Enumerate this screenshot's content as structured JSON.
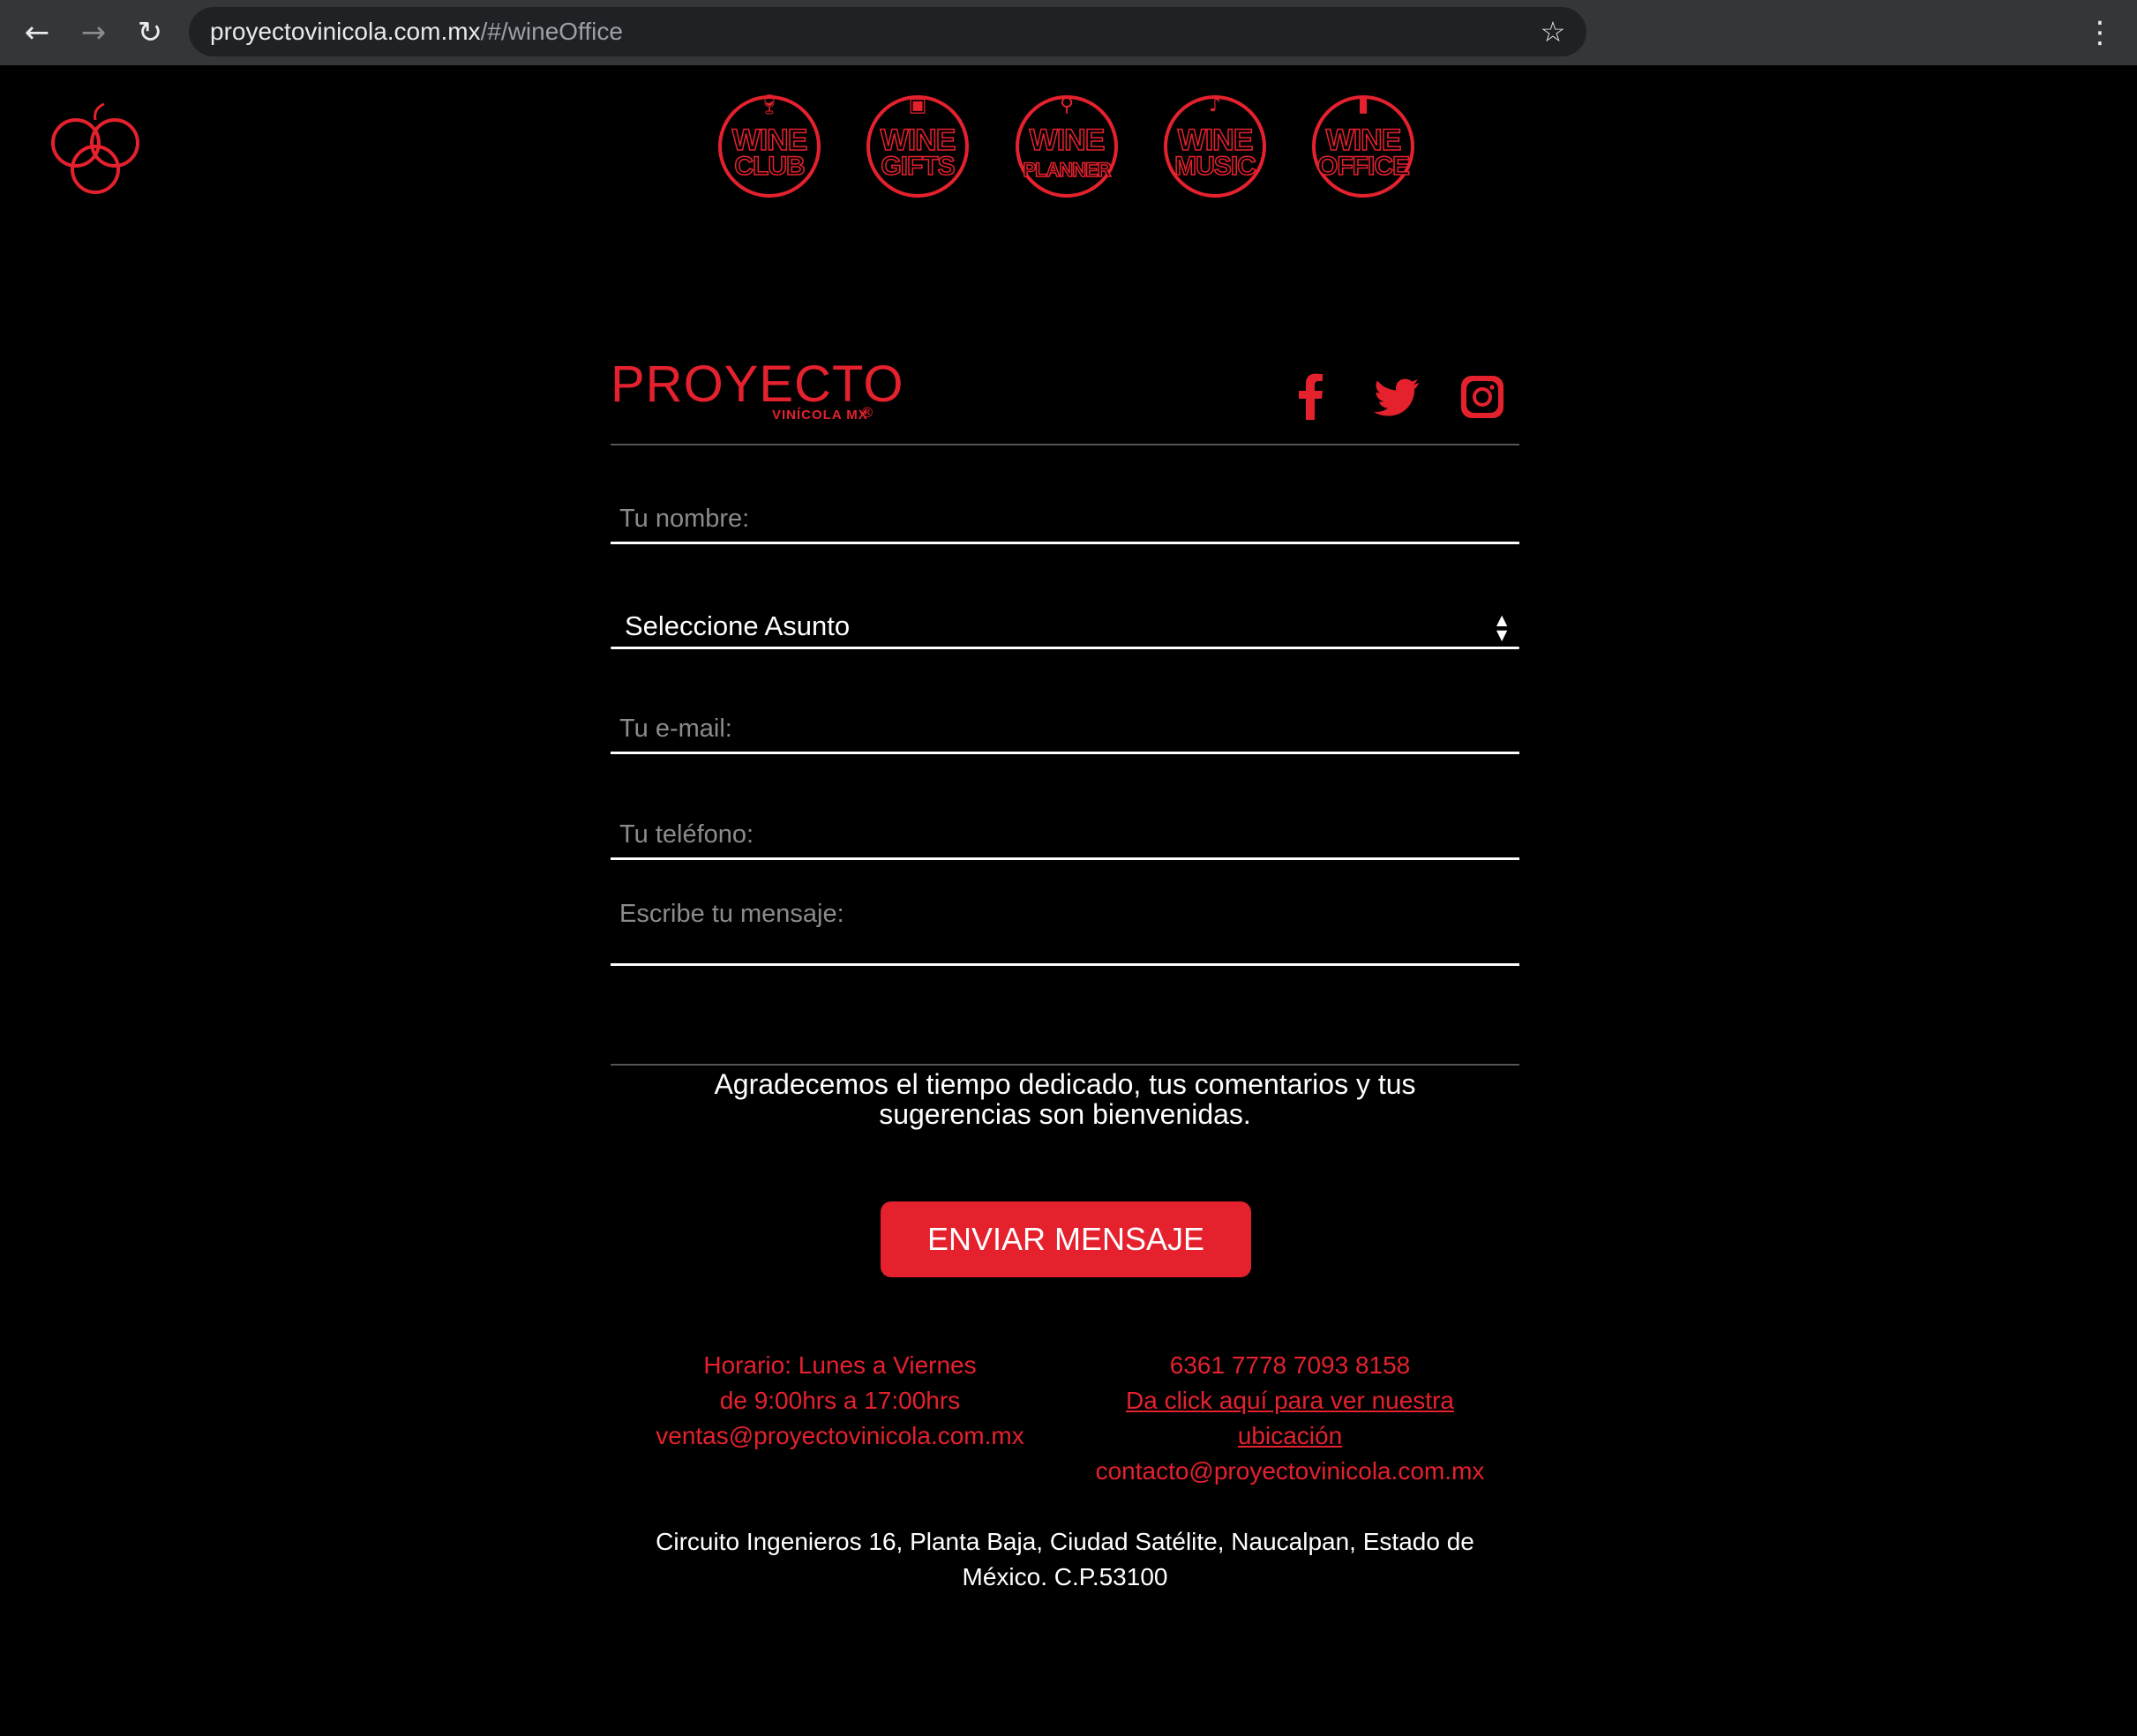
{
  "browser": {
    "url_host": "proyectovinicola.com.mx",
    "url_path": "/#/wineOffice"
  },
  "colors": {
    "accent": "#e5212e",
    "background": "#000000"
  },
  "nav": {
    "items": [
      {
        "line1": "WINE",
        "line2": "CLUB",
        "icon": "wine-glass-icon"
      },
      {
        "line1": "WINE",
        "line2": "GIFTS",
        "icon": "gift-icon"
      },
      {
        "line1": "WINE",
        "line2": "PLANNER",
        "icon": "planner-icon"
      },
      {
        "line1": "WINE",
        "line2": "MUSIC",
        "icon": "music-note-icon"
      },
      {
        "line1": "WINE",
        "line2": "OFFICE",
        "icon": "wine-bottle-icon"
      }
    ]
  },
  "brand": {
    "main": "PROYECTO",
    "sub": "VINÍCOLA MX",
    "reg": "®"
  },
  "social": [
    "facebook-icon",
    "twitter-icon",
    "instagram-icon"
  ],
  "form": {
    "name_placeholder": "Tu nombre:",
    "subject_selected": "Seleccione Asunto",
    "email_placeholder": "Tu e-mail:",
    "phone_placeholder": "Tu teléfono:",
    "message_placeholder": "Escribe tu mensaje:"
  },
  "thanks_line1": "Agradecemos el tiempo dedicado, tus comentarios y tus",
  "thanks_line2": "sugerencias son bienvenidas.",
  "send_label": "ENVIAR MENSAJE",
  "info_left": {
    "line1": "Horario: Lunes a Viernes",
    "line2": "de 9:00hrs a 17:00hrs",
    "email": "ventas@proyectovinicola.com.mx"
  },
  "info_right": {
    "phone": "6361 7778 7093 8158",
    "link_line1": "Da click aquí para ver nuestra",
    "link_line2": "ubicación",
    "email": "contacto@proyectovinicola.com.mx"
  },
  "address_line1": "Circuito Ingenieros 16, Planta Baja, Ciudad Satélite, Naucalpan, Estado de",
  "address_line2": "México. C.P.53100"
}
